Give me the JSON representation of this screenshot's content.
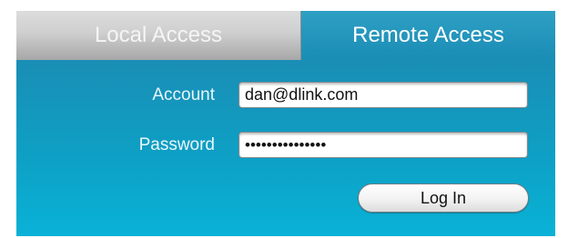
{
  "tabs": [
    {
      "label": "Local Access",
      "selected": false
    },
    {
      "label": "Remote Access",
      "selected": true
    }
  ],
  "form": {
    "account_label": "Account",
    "account_value": "dan@dlink.com",
    "password_label": "Password",
    "password_value": "•••••••••••••••",
    "login_label": "Log In"
  },
  "colors": {
    "panel": "#0ea0c5",
    "inactive_tab": "#c7c7c7",
    "active_tab": "#1a8db5"
  }
}
